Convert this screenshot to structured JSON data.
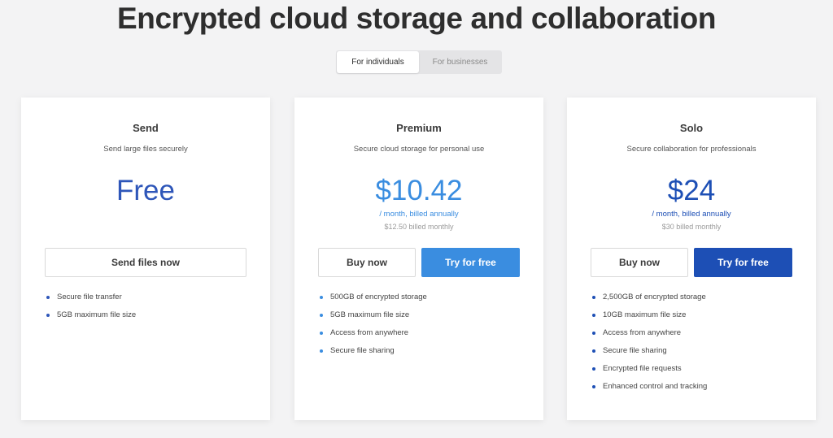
{
  "headline": "Encrypted cloud storage and collaboration",
  "toggle": {
    "individuals": "For individuals",
    "businesses": "For businesses"
  },
  "colors": {
    "send_price": "#2e56b9",
    "premium_accent": "#3a8de0",
    "solo_accent": "#1d4fb5"
  },
  "plans": {
    "send": {
      "name": "Send",
      "description": "Send large files securely",
      "price": "Free",
      "button": "Send files now",
      "features": [
        "Secure file transfer",
        "5GB maximum file size"
      ]
    },
    "premium": {
      "name": "Premium",
      "description": "Secure cloud storage for personal use",
      "price": "$10.42",
      "billing": "/ month, billed annually",
      "monthly": "$12.50 billed monthly",
      "buy_button": "Buy now",
      "try_button": "Try for free",
      "features": [
        "500GB of encrypted storage",
        "5GB maximum file size",
        "Access from anywhere",
        "Secure file sharing"
      ]
    },
    "solo": {
      "name": "Solo",
      "description": "Secure collaboration for professionals",
      "price": "$24",
      "billing": "/ month, billed annually",
      "monthly": "$30 billed monthly",
      "buy_button": "Buy now",
      "try_button": "Try for free",
      "features": [
        "2,500GB of encrypted storage",
        "10GB maximum file size",
        "Access from anywhere",
        "Secure file sharing",
        "Encrypted file requests",
        "Enhanced control and tracking"
      ]
    }
  }
}
